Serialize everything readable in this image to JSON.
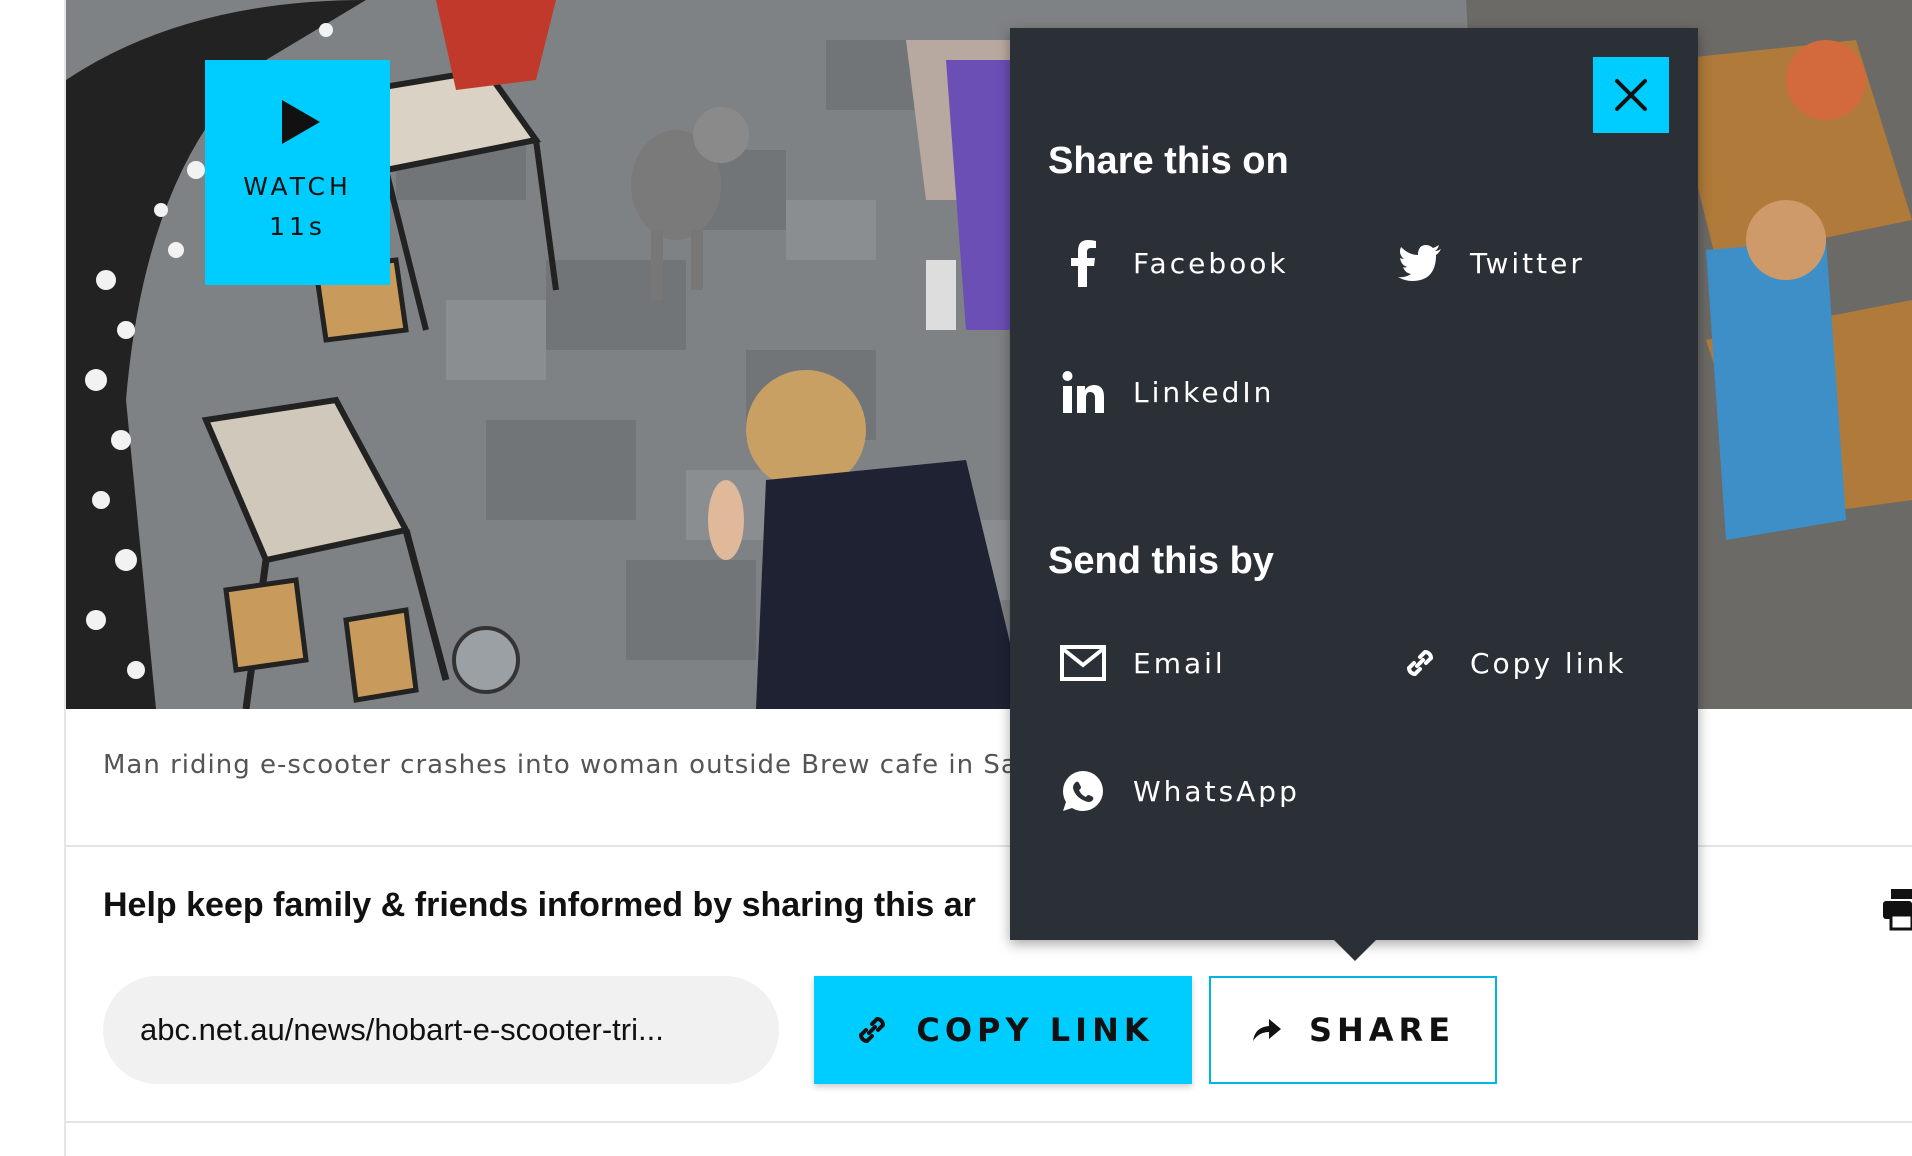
{
  "video": {
    "watch_label": "WATCH",
    "duration": "11s",
    "caption": "Man riding e-scooter crashes into woman outside Brew cafe in Sa"
  },
  "share_bar": {
    "heading": "Help keep family & friends informed by sharing this ar",
    "url": "abc.net.au/news/hobart-e-scooter-tri...",
    "copy_link_label": "COPY LINK",
    "share_label": "SHARE"
  },
  "popover": {
    "share_heading": "Share this on",
    "send_heading": "Send this by",
    "share_options": [
      {
        "label": "Facebook",
        "icon": "facebook-icon"
      },
      {
        "label": "Twitter",
        "icon": "twitter-icon"
      },
      {
        "label": "LinkedIn",
        "icon": "linkedin-icon"
      }
    ],
    "send_options": [
      {
        "label": "Email",
        "icon": "email-icon"
      },
      {
        "label": "Copy link",
        "icon": "link-icon"
      },
      {
        "label": "WhatsApp",
        "icon": "whatsapp-icon"
      }
    ]
  },
  "colors": {
    "accent": "#00cdff",
    "popover_bg": "#2b3037",
    "pill_bg": "#f1f1f1"
  }
}
